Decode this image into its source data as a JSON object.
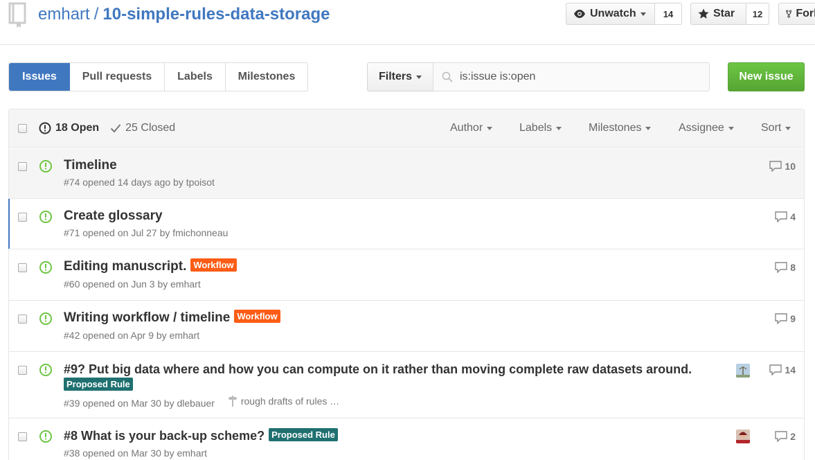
{
  "repo": {
    "owner": "emhart",
    "separator": "/",
    "name": "10-simple-rules-data-storage",
    "unwatch_label": "Unwatch",
    "watch_count": "14",
    "star_label": "Star",
    "star_count": "12",
    "fork_label": "Fork"
  },
  "subnav": {
    "tabs": [
      {
        "label": "Issues",
        "selected": true
      },
      {
        "label": "Pull requests"
      },
      {
        "label": "Labels"
      },
      {
        "label": "Milestones"
      }
    ],
    "filters_label": "Filters",
    "search_value": "is:issue is:open",
    "new_issue_label": "New issue"
  },
  "list_header": {
    "open_label": "18 Open",
    "closed_label": "25 Closed",
    "filters": [
      "Author",
      "Labels",
      "Milestones",
      "Assignee",
      "Sort"
    ]
  },
  "issues": [
    {
      "title": "Timeline",
      "meta": "#74 opened 14 days ago by tpoisot",
      "comments": "10"
    },
    {
      "title": "Create glossary",
      "meta": "#71 opened on Jul 27 by fmichonneau",
      "comments": "4"
    },
    {
      "title": "Editing manuscript.",
      "label": "Workflow",
      "meta": "#60 opened on Jun 3 by emhart",
      "comments": "8"
    },
    {
      "title": "Writing workflow / timeline",
      "label": "Workflow",
      "meta": "#42 opened on Apr 9 by emhart",
      "comments": "9"
    },
    {
      "title": "#9? Put big data where and how you can compute on it rather than moving complete raw datasets around.",
      "label": "Proposed Rule",
      "meta": "#39 opened on Mar 30 by dlebauer",
      "milestone": "rough drafts of rules …",
      "comments": "14"
    },
    {
      "title": "#8 What is your back-up scheme?",
      "label": "Proposed Rule",
      "meta": "#38 opened on Mar 30 by emhart",
      "comments": "2"
    }
  ],
  "colors": {
    "link": "#4078c0",
    "open_green": "#6cc644",
    "label_workflow": "#fc5c15",
    "label_proposed": "#207070"
  }
}
